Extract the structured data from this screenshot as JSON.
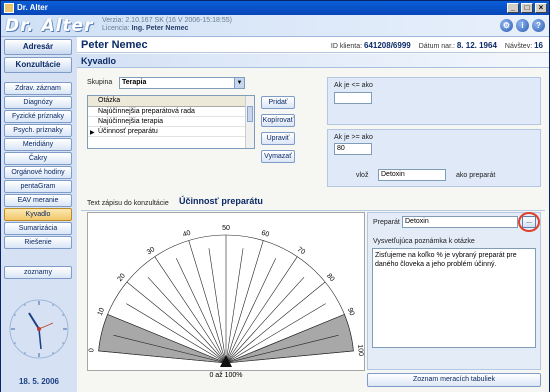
{
  "window": {
    "title": "Dr. Alter"
  },
  "header": {
    "logo": "Dr. Alter",
    "version": "Verzia: 2.10.167 SK (16 V 2006-15:18:55)",
    "license_label": "Licencia:",
    "license_name": "Ing. Peter Nemec"
  },
  "sidebar": {
    "top_buttons": [
      "Adresár",
      "Konzultácie"
    ],
    "items": [
      "Zdrav. záznam",
      "Diagnózy",
      "Fyzické príznaky",
      "Psych. príznaky",
      "Meridiány",
      "Čakry",
      "Orgánové hodiny",
      "pentaGram",
      "EAV meranie",
      "Kyvadlo",
      "Sumarizácia",
      "Riešenie"
    ],
    "extra": "zoznamy",
    "date": "18. 5. 2006"
  },
  "patient": {
    "name": "Peter Nemec",
    "id_label": "ID klienta:",
    "id_value": "641208/6999",
    "dob_label": "Dátum nar.:",
    "dob_value": "8. 12. 1964",
    "visits_label": "Návštev:",
    "visits_value": "16"
  },
  "section": {
    "title": "Kyvadlo"
  },
  "group": {
    "label": "Skupina",
    "value": "Terapia"
  },
  "questions": {
    "header": "Otázka",
    "rows": [
      "Najúčinnejšia preparátová rada",
      "Najúčinnejšia terapia",
      "Účinnosť preparátu"
    ],
    "selected_index": 2
  },
  "actions": {
    "add": "Pridať",
    "copy": "Kopírovať",
    "edit": "Upraviť",
    "delete": "Vymazať"
  },
  "conditions": {
    "le_label": "Ak je <= ako",
    "le_value": "",
    "ge_label": "Ak je >= ako",
    "ge_value": "80",
    "insert_label": "vlož",
    "insert_value": "Detoxin",
    "insert_suffix": "ako preparát"
  },
  "entry": {
    "label": "Text zápisu do konzultácie",
    "value": "Účinnosť preparátu"
  },
  "gauge": {
    "ticks": [
      "0",
      "10",
      "20",
      "30",
      "40",
      "50",
      "60",
      "70",
      "80",
      "90",
      "100"
    ],
    "caption": "0 až 100%",
    "shaded_below": 0.1
  },
  "preparat": {
    "label": "Preparát",
    "value": "Detoxin",
    "browse": "..."
  },
  "note": {
    "label": "Vysvetľujúca poznámka k otázke",
    "text": "Zisťujeme na koľko % je vybraný preparát pre daného človeka a jeho problém účinný."
  },
  "tables_button": "Zoznam meracích tabuliek"
}
